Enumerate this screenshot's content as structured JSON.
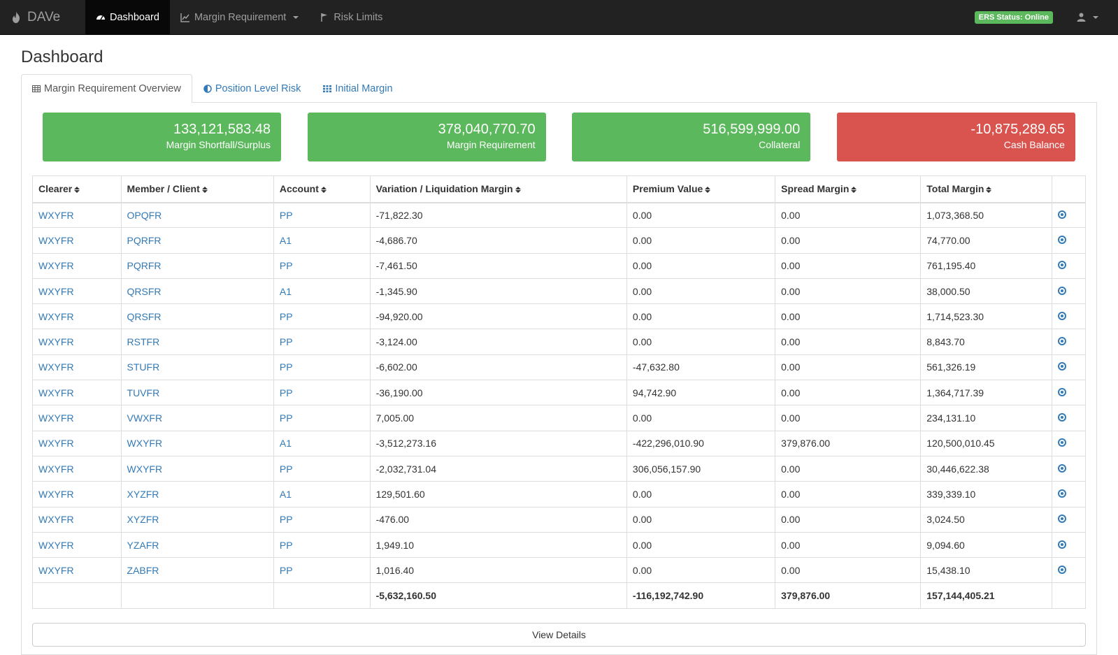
{
  "app": {
    "brand": "DAVe"
  },
  "nav": {
    "dashboard": "Dashboard",
    "margin_requirement": "Margin Requirement",
    "risk_limits": "Risk Limits",
    "ers_status": "ERS Status: Online"
  },
  "page": {
    "title": "Dashboard"
  },
  "tabs": [
    "Margin Requirement Overview",
    "Position Level Risk",
    "Initial Margin"
  ],
  "stats": [
    {
      "value": "133,121,583.48",
      "label": "Margin Shortfall/Surplus",
      "color": "#5cb85c"
    },
    {
      "value": "378,040,770.70",
      "label": "Margin Requirement",
      "color": "#5cb85c"
    },
    {
      "value": "516,599,999.00",
      "label": "Collateral",
      "color": "#5cb85c"
    },
    {
      "value": "-10,875,289.65",
      "label": "Cash Balance",
      "color": "#d9534f"
    }
  ],
  "table": {
    "headers": [
      "Clearer",
      "Member / Client",
      "Account",
      "Variation / Liquidation Margin",
      "Premium Value",
      "Spread Margin",
      "Total Margin"
    ],
    "rows": [
      [
        "WXYFR",
        "OPQFR",
        "PP",
        "-71,822.30",
        "0.00",
        "0.00",
        "1,073,368.50"
      ],
      [
        "WXYFR",
        "PQRFR",
        "A1",
        "-4,686.70",
        "0.00",
        "0.00",
        "74,770.00"
      ],
      [
        "WXYFR",
        "PQRFR",
        "PP",
        "-7,461.50",
        "0.00",
        "0.00",
        "761,195.40"
      ],
      [
        "WXYFR",
        "QRSFR",
        "A1",
        "-1,345.90",
        "0.00",
        "0.00",
        "38,000.50"
      ],
      [
        "WXYFR",
        "QRSFR",
        "PP",
        "-94,920.00",
        "0.00",
        "0.00",
        "1,714,523.30"
      ],
      [
        "WXYFR",
        "RSTFR",
        "PP",
        "-3,124.00",
        "0.00",
        "0.00",
        "8,843.70"
      ],
      [
        "WXYFR",
        "STUFR",
        "PP",
        "-6,602.00",
        "-47,632.80",
        "0.00",
        "561,326.19"
      ],
      [
        "WXYFR",
        "TUVFR",
        "PP",
        "-36,190.00",
        "94,742.90",
        "0.00",
        "1,364,717.39"
      ],
      [
        "WXYFR",
        "VWXFR",
        "PP",
        "7,005.00",
        "0.00",
        "0.00",
        "234,131.10"
      ],
      [
        "WXYFR",
        "WXYFR",
        "A1",
        "-3,512,273.16",
        "-422,296,010.90",
        "379,876.00",
        "120,500,010.45"
      ],
      [
        "WXYFR",
        "WXYFR",
        "PP",
        "-2,032,731.04",
        "306,056,157.90",
        "0.00",
        "30,446,622.38"
      ],
      [
        "WXYFR",
        "XYZFR",
        "A1",
        "129,501.60",
        "0.00",
        "0.00",
        "339,339.10"
      ],
      [
        "WXYFR",
        "XYZFR",
        "PP",
        "-476.00",
        "0.00",
        "0.00",
        "3,024.50"
      ],
      [
        "WXYFR",
        "YZAFR",
        "PP",
        "1,949.10",
        "0.00",
        "0.00",
        "9,094.60"
      ],
      [
        "WXYFR",
        "ZABFR",
        "PP",
        "1,016.40",
        "0.00",
        "0.00",
        "15,438.10"
      ]
    ],
    "totals": [
      "",
      "",
      "",
      "-5,632,160.50",
      "-116,192,742.90",
      "379,876.00",
      "157,144,405.21"
    ]
  },
  "view_details": "View Details",
  "icons": {
    "brand": "flame-icon",
    "dashboard": "dashboard-icon",
    "margin_requirement": "line-chart-icon",
    "risk_limits": "flag-icon",
    "user": "user-icon",
    "tab_overview": "table-icon",
    "tab_position": "half-circle-icon",
    "tab_initial": "grid-icon",
    "row_detail": "eye-icon"
  }
}
